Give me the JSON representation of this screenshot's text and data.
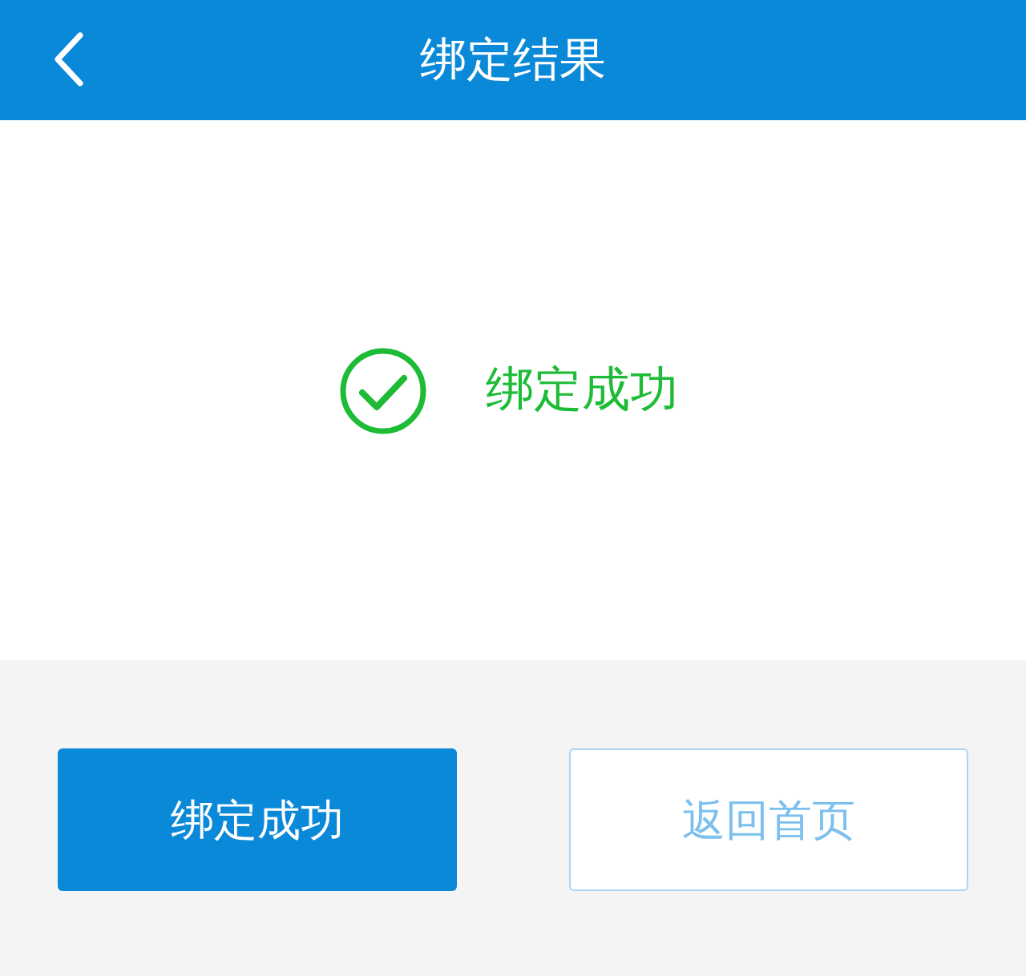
{
  "header": {
    "title": "绑定结果"
  },
  "result": {
    "success": true,
    "message": "绑定成功"
  },
  "buttons": [
    {
      "label": "绑定成功",
      "kind": "primary"
    },
    {
      "label": "返回首页",
      "kind": "secondary"
    }
  ]
}
